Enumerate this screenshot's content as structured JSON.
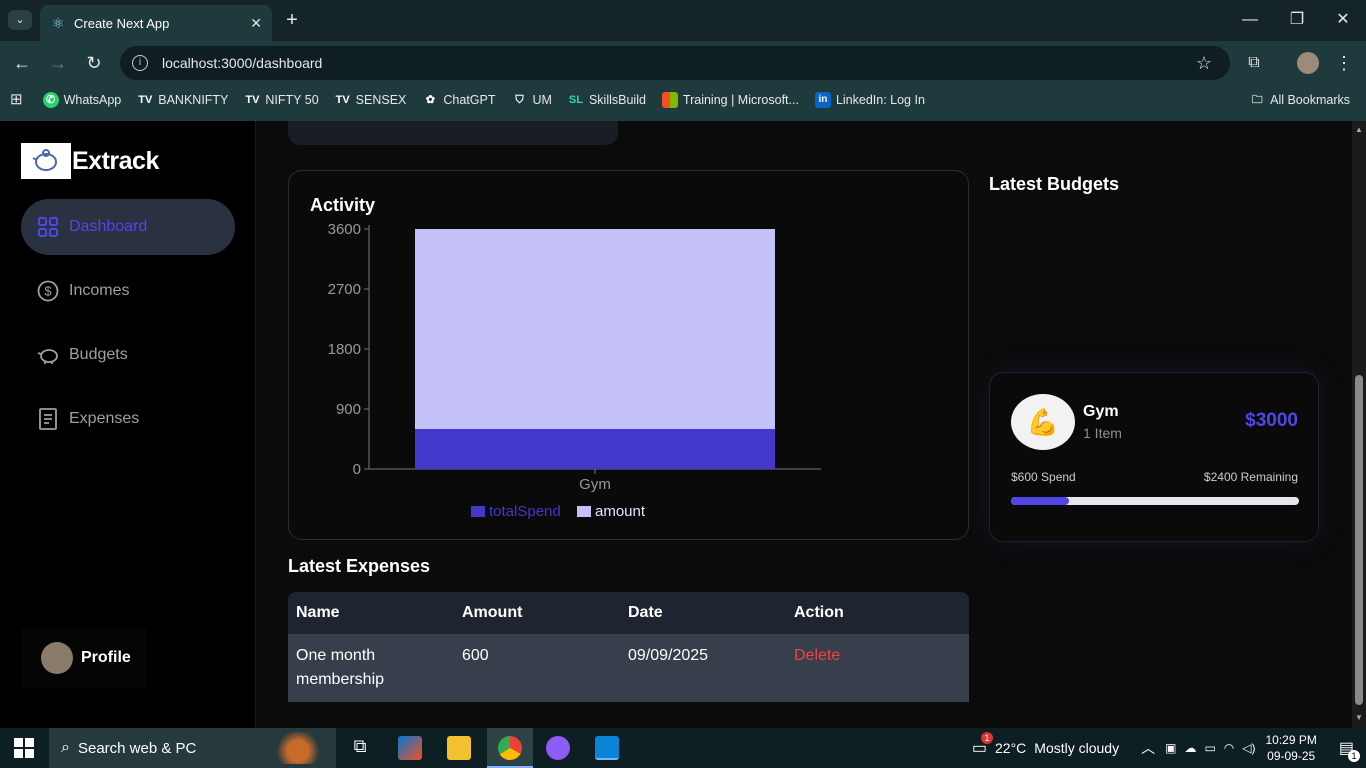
{
  "browser": {
    "tab_title": "Create Next App",
    "url": "localhost:3000/dashboard",
    "bookmarks": [
      {
        "label": "WhatsApp",
        "color": "#25d366"
      },
      {
        "label": "BANKNIFTY",
        "color": "#ffffff"
      },
      {
        "label": "NIFTY 50",
        "color": "#ffffff"
      },
      {
        "label": "SENSEX",
        "color": "#ffffff"
      },
      {
        "label": "ChatGPT",
        "color": "#ffffff"
      },
      {
        "label": "UM",
        "color": "#ffffff"
      },
      {
        "label": "SkillsBuild",
        "color": "#2bd9b5"
      },
      {
        "label": "Training | Microsoft...",
        "color": "#f25022"
      },
      {
        "label": "LinkedIn: Log In",
        "color": "#0a66c2"
      }
    ],
    "all_bookmarks": "All Bookmarks"
  },
  "sidebar": {
    "app_name": "Extrack",
    "items": [
      {
        "label": "Dashboard",
        "icon": "grid-icon",
        "active": true
      },
      {
        "label": "Incomes",
        "icon": "dollar-circle-icon",
        "active": false
      },
      {
        "label": "Budgets",
        "icon": "piggy-bank-icon",
        "active": false
      },
      {
        "label": "Expenses",
        "icon": "receipt-icon",
        "active": false
      }
    ],
    "profile_label": "Profile"
  },
  "activity": {
    "title": "Activity"
  },
  "chart_data": {
    "type": "bar",
    "stacked": true,
    "categories": [
      "Gym"
    ],
    "series": [
      {
        "name": "totalSpend",
        "values": [
          600
        ],
        "color": "#4338ca"
      },
      {
        "name": "amount",
        "values": [
          3000
        ],
        "color": "#c4c1f9"
      }
    ],
    "yticks": [
      0,
      900,
      1800,
      2700,
      3600
    ],
    "ylim": [
      0,
      3600
    ],
    "legend": "bottom"
  },
  "latest_budgets": {
    "title": "Latest Budgets",
    "budget": {
      "icon": "flexed-biceps-icon",
      "name": "Gym",
      "items": "1 Item",
      "amount": "$3000",
      "spend": "$600 Spend",
      "remaining": "$2400 Remaining",
      "progress": 0.2
    }
  },
  "latest_expenses": {
    "title": "Latest Expenses",
    "headers": [
      "Name",
      "Amount",
      "Date",
      "Action"
    ],
    "rows": [
      {
        "name": "One month membership",
        "amount": "600",
        "date": "09/09/2025",
        "action": "Delete"
      }
    ]
  },
  "taskbar": {
    "search_placeholder": "Search web & PC",
    "weather_temp": "22°C",
    "weather_text": "Mostly cloudy",
    "time": "10:29 PM",
    "date": "09-09-25",
    "weather_badge": "1",
    "notif_count": "1"
  }
}
